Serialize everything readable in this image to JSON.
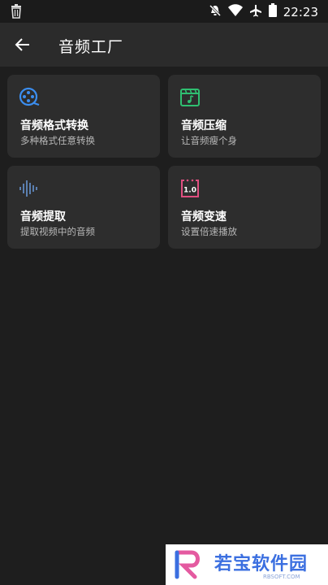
{
  "status_bar": {
    "time": "22:23",
    "icons": [
      "trash-icon",
      "mute-icon",
      "wifi-icon",
      "airplane-icon",
      "battery-icon"
    ]
  },
  "app_bar": {
    "title": "音频工厂",
    "back_icon": "arrow-left-icon"
  },
  "tools": [
    {
      "title": "音频格式转换",
      "subtitle": "多种格式任意转换",
      "icon": "film-reel-icon",
      "color": "#3b8ef0"
    },
    {
      "title": "音频压缩",
      "subtitle": "让音频瘦个身",
      "icon": "clapperboard-music-icon",
      "color": "#2fbf71"
    },
    {
      "title": "音频提取",
      "subtitle": "提取视频中的音频",
      "icon": "waveform-icon",
      "color": "#5b7fb0"
    },
    {
      "title": "音频变速",
      "subtitle": "设置倍速播放",
      "icon": "speed-1x-icon",
      "color": "#e04f80",
      "badge": "1.0"
    }
  ],
  "watermark": {
    "text": "若宝软件园",
    "sub": "RBSOFT.COM"
  },
  "colors": {
    "background": "#1e1e1e",
    "app_bar": "#2b2b2b",
    "card": "#2d2d2d"
  }
}
